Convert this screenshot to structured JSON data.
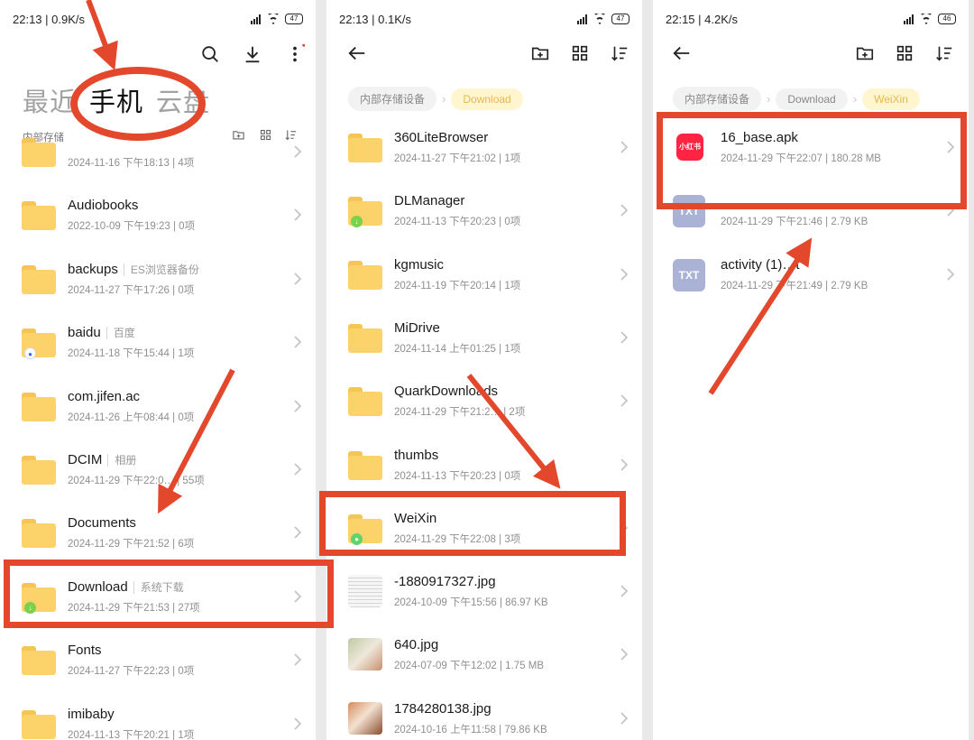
{
  "colors": {
    "folder": "#fcd26b",
    "annotation_red": "#e3472c",
    "crumb_active_text": "#e6b84a",
    "wechat_green": "#5ed46b",
    "download_green": "#7ad14b"
  },
  "panel1": {
    "status": {
      "time": "22:13 | 0.9K/s",
      "battery": "47"
    },
    "toolbar": {
      "icons": [
        "search-icon",
        "download-icon",
        "more-icon"
      ]
    },
    "tabs": [
      "最近",
      "手机",
      "云盘"
    ],
    "active_tab": "手机",
    "section_label": "内部存储",
    "items": [
      {
        "name": "",
        "tag": "",
        "meta": "2024-11-16 下午18:13 | 4项",
        "badge": ""
      },
      {
        "name": "Audiobooks",
        "tag": "",
        "meta": "2022-10-09 下午19:23 | 0项",
        "badge": ""
      },
      {
        "name": "backups",
        "tag": "ES浏览器备份",
        "meta": "2024-11-27 下午17:26 | 0项",
        "badge": ""
      },
      {
        "name": "baidu",
        "tag": "百度",
        "meta": "2024-11-18 下午15:44 | 1项",
        "badge": "baidu"
      },
      {
        "name": "com.jifen.ac",
        "tag": "",
        "meta": "2024-11-26 上午08:44 | 0项",
        "badge": ""
      },
      {
        "name": "DCIM",
        "tag": "相册",
        "meta": "2024-11-29 下午22:0… | 55项",
        "badge": ""
      },
      {
        "name": "Documents",
        "tag": "",
        "meta": "2024-11-29 下午21:52 | 6项",
        "badge": ""
      },
      {
        "name": "Download",
        "tag": "系统下载",
        "meta": "2024-11-29 下午21:53 | 27项",
        "badge": "download"
      },
      {
        "name": "Fonts",
        "tag": "",
        "meta": "2024-11-27 下午22:23 | 0项",
        "badge": ""
      },
      {
        "name": "imibaby",
        "tag": "",
        "meta": "2024-11-13 下午20:21 | 1项",
        "badge": ""
      }
    ]
  },
  "panel2": {
    "status": {
      "time": "22:13 | 0.1K/s",
      "battery": "47"
    },
    "breadcrumbs": [
      "内部存储设备",
      "Download"
    ],
    "items": [
      {
        "name": "360LiteBrowser",
        "meta": "2024-11-27 下午21:02 | 1项",
        "kind": "folder",
        "badge": ""
      },
      {
        "name": "DLManager",
        "meta": "2024-11-13 下午20:23 | 0项",
        "kind": "folder",
        "badge": "download"
      },
      {
        "name": "kgmusic",
        "meta": "2024-11-19 下午20:14 | 1项",
        "kind": "folder",
        "badge": ""
      },
      {
        "name": "MiDrive",
        "meta": "2024-11-14 上午01:25 | 1项",
        "kind": "folder",
        "badge": ""
      },
      {
        "name": "QuarkDownloads",
        "meta": "2024-11-29 下午21:2… | 2项",
        "kind": "folder",
        "badge": ""
      },
      {
        "name": "thumbs",
        "meta": "2024-11-13 下午20:23 | 0项",
        "kind": "folder",
        "badge": ""
      },
      {
        "name": "WeiXin",
        "meta": "2024-11-29 下午22:08 | 3项",
        "kind": "folder",
        "badge": "wechat"
      },
      {
        "name": "-1880917327.jpg",
        "meta": "2024-10-09 下午15:56 | 86.97 KB",
        "kind": "image",
        "badge": ""
      },
      {
        "name": "640.jpg",
        "meta": "2024-07-09 下午12:02 | 1.75 MB",
        "kind": "image",
        "badge": ""
      },
      {
        "name": "1784280138.jpg",
        "meta": "2024-10-16 上午11:58 | 79.86 KB",
        "kind": "image",
        "badge": ""
      }
    ]
  },
  "panel3": {
    "status": {
      "time": "22:15 | 4.2K/s",
      "battery": "46"
    },
    "breadcrumbs": [
      "内部存储设备",
      "Download",
      "WeiXin"
    ],
    "items": [
      {
        "name": "16_base.apk",
        "meta": "2024-11-29 下午22:07 | 180.28 MB",
        "kind": "apk",
        "icon_label": "小红书"
      },
      {
        "name": "",
        "meta": "2024-11-29 下午21:46 | 2.79 KB",
        "kind": "txt",
        "icon_label": "TXT"
      },
      {
        "name": "activity (1)…t",
        "meta": "2024-11-29 下午21:49 | 2.79 KB",
        "kind": "txt",
        "icon_label": "TXT"
      }
    ]
  }
}
